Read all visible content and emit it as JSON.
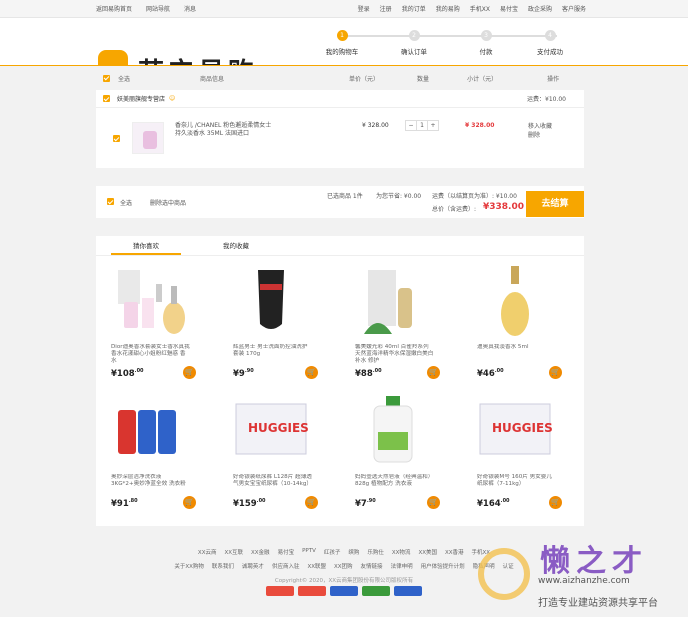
{
  "topbar": {
    "left": [
      "返回易购首页",
      "网站导航",
      "消息"
    ],
    "right": [
      "登录",
      "注册",
      "我的订单",
      "我的易购",
      "手机XX",
      "易付宝",
      "政企采购",
      "客户服务"
    ]
  },
  "logo": {
    "text": "苏宁易购"
  },
  "steps": [
    {
      "num": "1",
      "label": "我的购物车"
    },
    {
      "num": "2",
      "label": "确认订单"
    },
    {
      "num": "3",
      "label": "付款"
    },
    {
      "num": "4",
      "label": "支付成功"
    }
  ],
  "cart": {
    "head": {
      "select_all": "全选",
      "goods": "商品信息",
      "unit": "单价（元）",
      "qty": "数量",
      "subtotal": "小计（元）",
      "op": "操作"
    },
    "store": {
      "name": "妖美丽旗舰专营店",
      "shipping": "运费：¥10.00"
    },
    "item": {
      "title": "香奈儿 /CHANEL 粉色邂逅柔情女士持久淡香水 35ML 法国进口",
      "price": "¥ 328.00",
      "qty": "1",
      "subtotal": "¥ 328.00",
      "ops": [
        "移入收藏",
        "删除"
      ]
    },
    "summary": {
      "select_all": "全选",
      "delete": "删除选中商品",
      "selected": "已选商品 1件",
      "discount": "为您节省: ¥0.00",
      "shipping": "运费（以结算页为准）: ¥10.00",
      "total_label": "总价（含运费）:",
      "total": "¥338.00",
      "checkout": "去结算"
    }
  },
  "reco": {
    "tabs": [
      "猜你喜欢",
      "我的收藏"
    ],
    "items": [
      {
        "desc": "Dior迪奥香水套装女士香水真我香水花漾甜心小姐粉红魅惑 香水",
        "price": "¥108",
        "cents": ".00"
      },
      {
        "desc": "辉蓝男士 男士洗面奶控油洗护套装 170g",
        "price": "¥9",
        "cents": ".90"
      },
      {
        "desc": "馨美嫒光彩 40ml 百雀羚系列 天然蓝海洋精华水保湿嫩白美白 补水 修护",
        "price": "¥88",
        "cents": ".00"
      },
      {
        "desc": "迪奥真我淡香水 5ml",
        "price": "¥46",
        "cents": ".00"
      },
      {
        "desc": "奥妙深层洁净洗衣液 3KG*2+奥妙净蓝全效 洗衣粉",
        "price": "¥91",
        "cents": ".80"
      },
      {
        "desc": "好奇银装纸尿裤 L128片 超薄透气男女宝宝纸尿裤（10-14kg）",
        "price": "¥159",
        "cents": ".00"
      },
      {
        "desc": "妈妈壹选天然皂液（经典温和）828g 植物配方 洗衣液",
        "price": "¥7",
        "cents": ".90"
      },
      {
        "desc": "好奇银装M号 160片 男女婴儿纸尿裤（7-11kg）",
        "price": "¥164",
        "cents": ".00"
      }
    ]
  },
  "footer": {
    "row1": [
      "XX云商",
      "XX互联",
      "XX金融",
      "易付宝",
      "PPTV",
      "红孩子",
      "缤购",
      "乐购仕",
      "XX物流",
      "XX美国",
      "XX香港",
      "手机XX"
    ],
    "row2": [
      "关于XX购物",
      "联系我们",
      "诚聘英才",
      "供应商入驻",
      "XX联盟",
      "XX团购",
      "友情链接",
      "法律申明",
      "用户体验提升计划",
      "隐私声明",
      "认证"
    ],
    "copyright": "Copyright© 2020，XX云商集团股份有限公司版权所有"
  },
  "watermark": {
    "big": "懒之才",
    "url": "www.aizhanzhe.com",
    "slogan": "打造专业建站资源共享平台"
  }
}
